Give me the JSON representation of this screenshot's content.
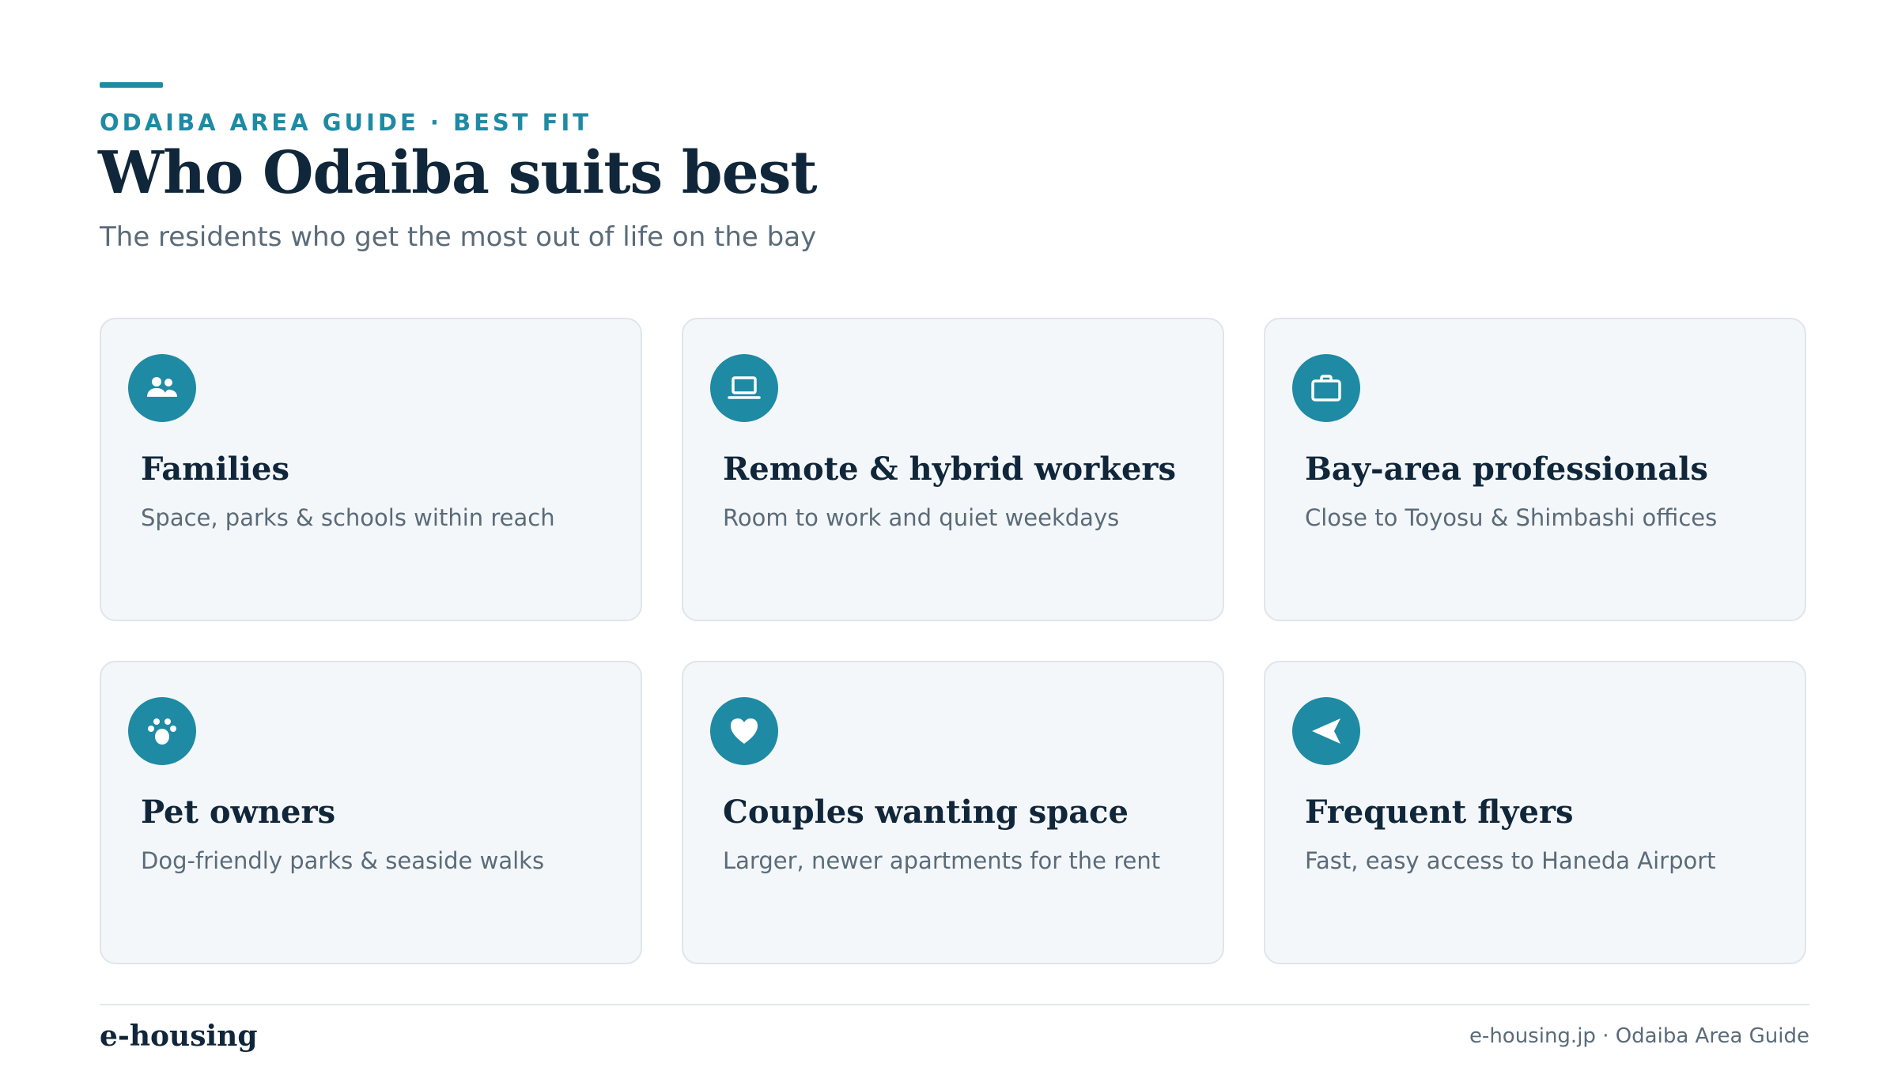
{
  "header": {
    "eyebrow": "ODAIBA AREA GUIDE · BEST FIT",
    "title": "Who Odaiba suits best",
    "subtitle": "The residents who get the most out of life on the bay"
  },
  "cards": [
    {
      "icon": "family-icon",
      "title": "Families",
      "description": "Space, parks & schools within reach"
    },
    {
      "icon": "laptop-icon",
      "title": "Remote & hybrid workers",
      "description": "Room to work and quiet weekdays"
    },
    {
      "icon": "briefcase-icon",
      "title": "Bay-area professionals",
      "description": "Close to Toyosu & Shimbashi offices"
    },
    {
      "icon": "paw-icon",
      "title": "Pet owners",
      "description": "Dog-friendly parks & seaside walks"
    },
    {
      "icon": "heart-icon",
      "title": "Couples wanting space",
      "description": "Larger, newer apartments for the rent"
    },
    {
      "icon": "plane-icon",
      "title": "Frequent flyers",
      "description": "Fast, easy access to Haneda Airport"
    }
  ],
  "footer": {
    "brand": "e-housing",
    "source": "e-housing.jp · Odaiba Area Guide"
  },
  "colors": {
    "accent": "#1f8aa3",
    "heading": "#10263a",
    "muted": "#5a6b79",
    "card_bg": "#f4f7fa"
  }
}
